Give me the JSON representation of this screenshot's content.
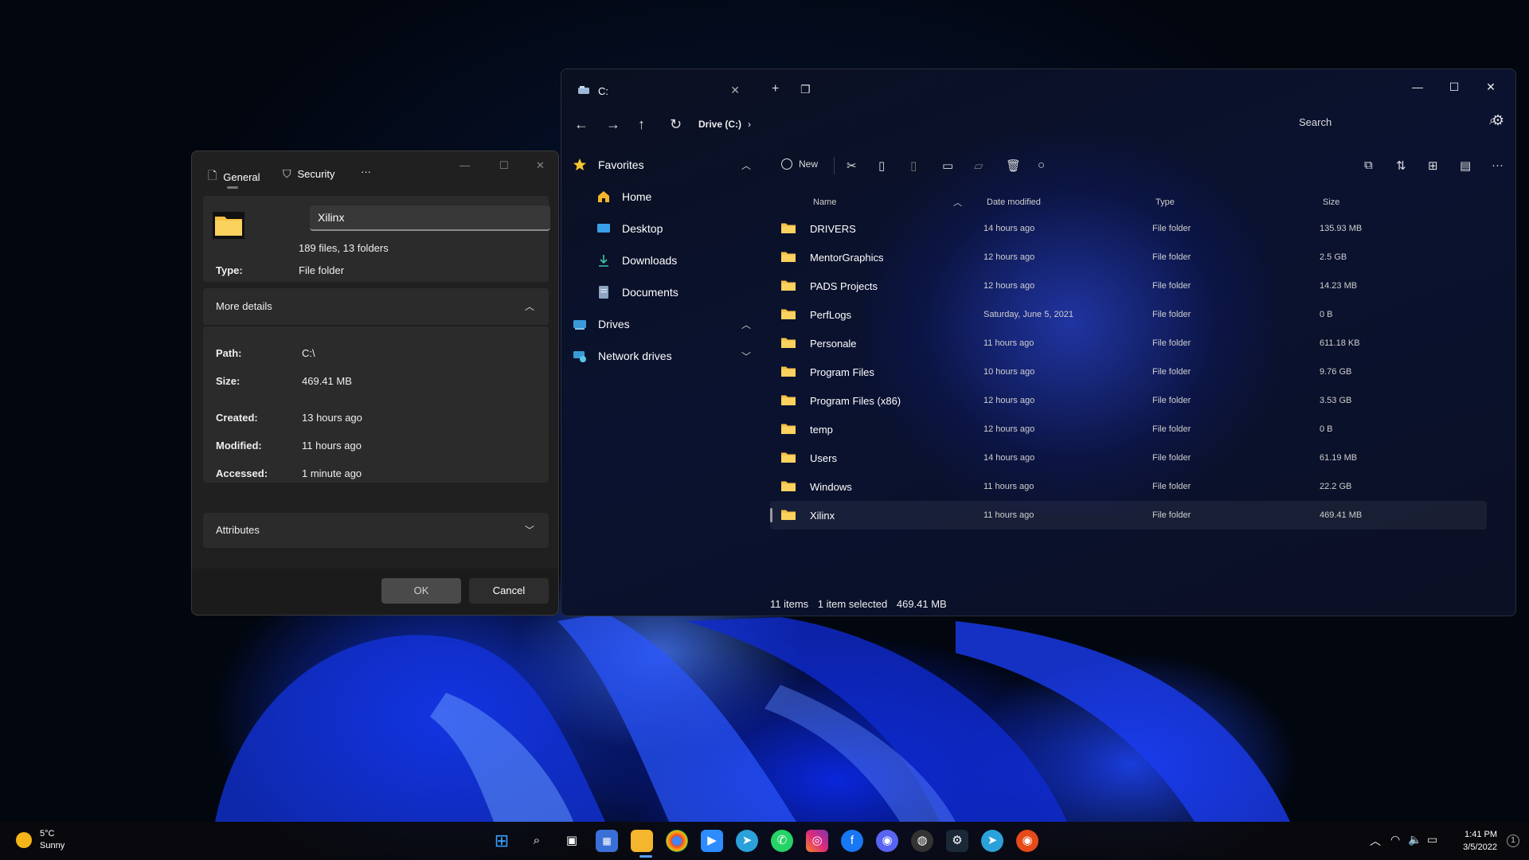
{
  "explorer": {
    "tab_title": "C:",
    "breadcrumb": "Drive (C:)",
    "search_placeholder": "Search",
    "sidebar": [
      {
        "label": "Favorites",
        "level": "top",
        "icon": "star-icon",
        "chevron": "up"
      },
      {
        "label": "Home",
        "level": "sub",
        "icon": "home-icon"
      },
      {
        "label": "Desktop",
        "level": "sub",
        "icon": "desktop-icon"
      },
      {
        "label": "Downloads",
        "level": "sub",
        "icon": "download-icon"
      },
      {
        "label": "Documents",
        "level": "sub",
        "icon": "document-icon"
      },
      {
        "label": "Drives",
        "level": "top",
        "icon": "drive-icon",
        "chevron": "up"
      },
      {
        "label": "Network drives",
        "level": "top",
        "icon": "network-icon",
        "chevron": "down"
      }
    ],
    "toolbar": {
      "new_label": "New"
    },
    "columns": {
      "name": "Name",
      "date": "Date modified",
      "type": "Type",
      "size": "Size"
    },
    "files": [
      {
        "name": "DRIVERS",
        "date": "14 hours ago",
        "type": "File folder",
        "size": "135.93 MB"
      },
      {
        "name": "MentorGraphics",
        "date": "12 hours ago",
        "type": "File folder",
        "size": "2.5 GB"
      },
      {
        "name": "PADS Projects",
        "date": "12 hours ago",
        "type": "File folder",
        "size": "14.23 MB"
      },
      {
        "name": "PerfLogs",
        "date": "Saturday, June 5, 2021",
        "type": "File folder",
        "size": "0 B"
      },
      {
        "name": "Personale",
        "date": "11 hours ago",
        "type": "File folder",
        "size": "611.18 KB"
      },
      {
        "name": "Program Files",
        "date": "10 hours ago",
        "type": "File folder",
        "size": "9.76 GB"
      },
      {
        "name": "Program Files (x86)",
        "date": "12 hours ago",
        "type": "File folder",
        "size": "3.53 GB"
      },
      {
        "name": "temp",
        "date": "12 hours ago",
        "type": "File folder",
        "size": "0 B"
      },
      {
        "name": "Users",
        "date": "14 hours ago",
        "type": "File folder",
        "size": "61.19 MB"
      },
      {
        "name": "Windows",
        "date": "11 hours ago",
        "type": "File folder",
        "size": "22.2 GB"
      },
      {
        "name": "Xilinx",
        "date": "11 hours ago",
        "type": "File folder",
        "size": "469.41 MB",
        "selected": true
      }
    ],
    "status": {
      "items": "11 items",
      "selected": "1 item selected",
      "size": "469.41 MB"
    }
  },
  "properties": {
    "tabs": {
      "general": "General",
      "security": "Security",
      "more": "···"
    },
    "name": "Xilinx",
    "contents": "189 files, 13 folders",
    "type_label": "Type:",
    "type_value": "File folder",
    "more_details": "More details",
    "path_label": "Path:",
    "path_value": "C:\\",
    "size_label": "Size:",
    "size_value": "469.41 MB",
    "created_label": "Created:",
    "created_value": "13 hours ago",
    "modified_label": "Modified:",
    "modified_value": "11 hours ago",
    "accessed_label": "Accessed:",
    "accessed_value": "1 minute ago",
    "attributes": "Attributes",
    "ok": "OK",
    "cancel": "Cancel"
  },
  "taskbar": {
    "weather_temp": "5°C",
    "weather_desc": "Sunny",
    "time": "1:41 PM",
    "date": "3/5/2022",
    "notification_count": "1"
  },
  "colors": {
    "folder": "#f8c146",
    "accent": "#2a4dff"
  }
}
